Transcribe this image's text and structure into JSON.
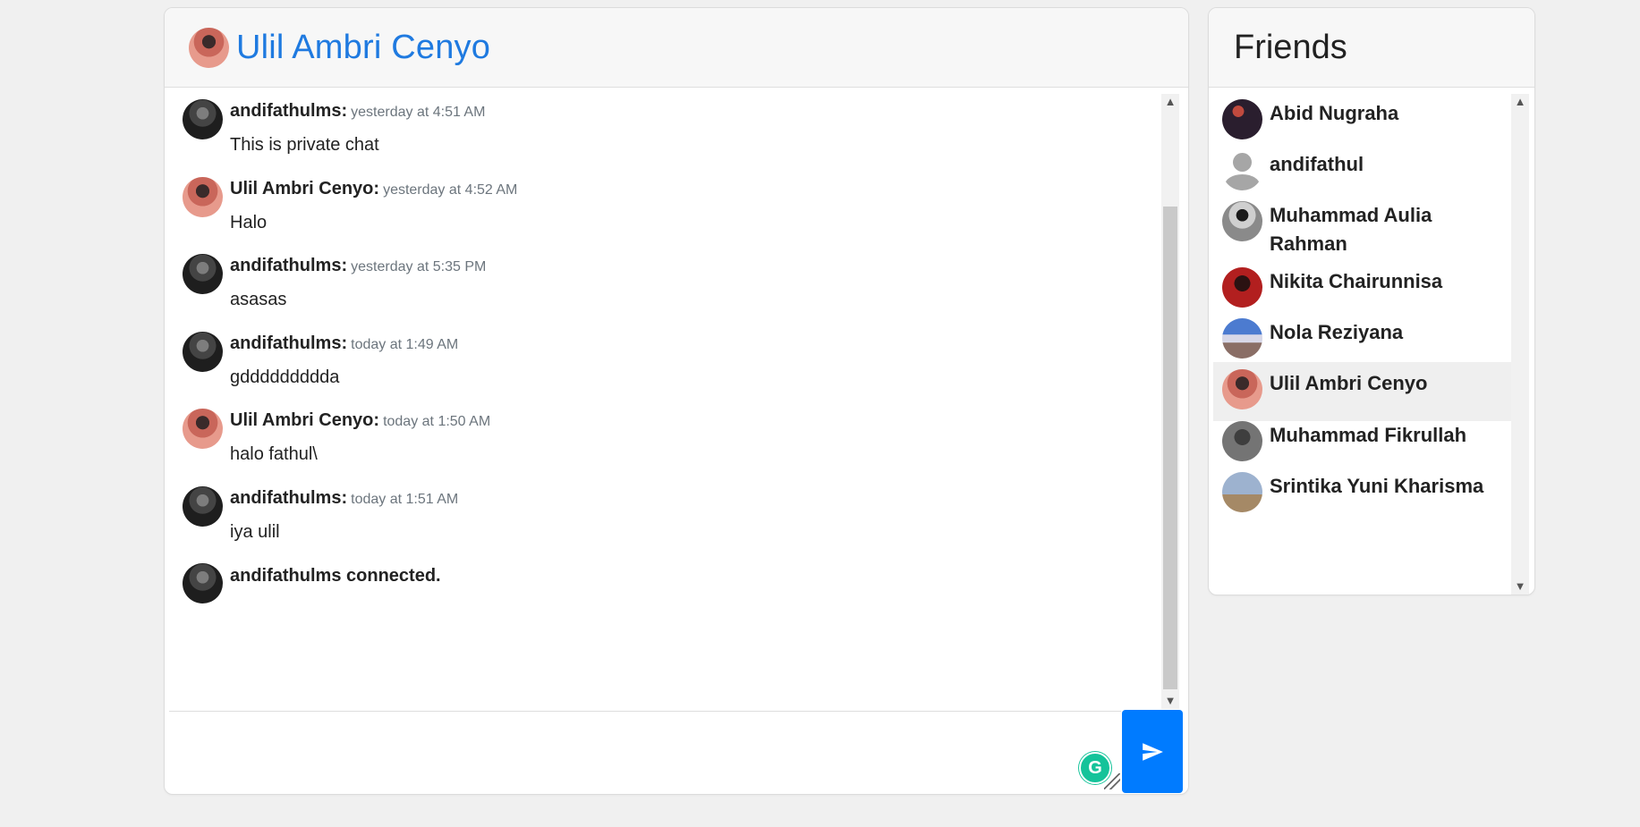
{
  "chat": {
    "title": "Ulil Ambri Cenyo",
    "messages": [
      {
        "author": "andifathulms:",
        "time": "yesterday at 4:51 AM",
        "text": "This is private chat"
      },
      {
        "author": "Ulil Ambri Cenyo:",
        "time": "yesterday at 4:52 AM",
        "text": "Halo"
      },
      {
        "author": "andifathulms:",
        "time": "yesterday at 5:35 PM",
        "text": "asasas"
      },
      {
        "author": "andifathulms:",
        "time": "today at 1:49 AM",
        "text": "gddddddddda"
      },
      {
        "author": "Ulil Ambri Cenyo:",
        "time": "today at 1:50 AM",
        "text": "halo fathul\\"
      },
      {
        "author": "andifathulms:",
        "time": "today at 1:51 AM",
        "text": "iya ulil"
      }
    ],
    "system_message": "andifathulms connected.",
    "input_value": "",
    "grammarly_letter": "G"
  },
  "friends": {
    "title": "Friends",
    "items": [
      {
        "name": "Abid Nugraha"
      },
      {
        "name": "andifathul"
      },
      {
        "name": "Muhammad Aulia Rahman"
      },
      {
        "name": "Nikita Chairunnisa"
      },
      {
        "name": "Nola Reziyana"
      },
      {
        "name": "Ulil Ambri Cenyo",
        "active": true
      },
      {
        "name": "Muhammad Fikrullah"
      },
      {
        "name": "Srintika Yuni Kharisma"
      }
    ]
  },
  "icons": {
    "send": "send-icon",
    "scroll_up": "chevron-up-icon",
    "scroll_down": "chevron-down-icon"
  },
  "colors": {
    "accent": "#007bff",
    "title_blue": "#1f7ae0",
    "grammarly": "#15c39a"
  }
}
